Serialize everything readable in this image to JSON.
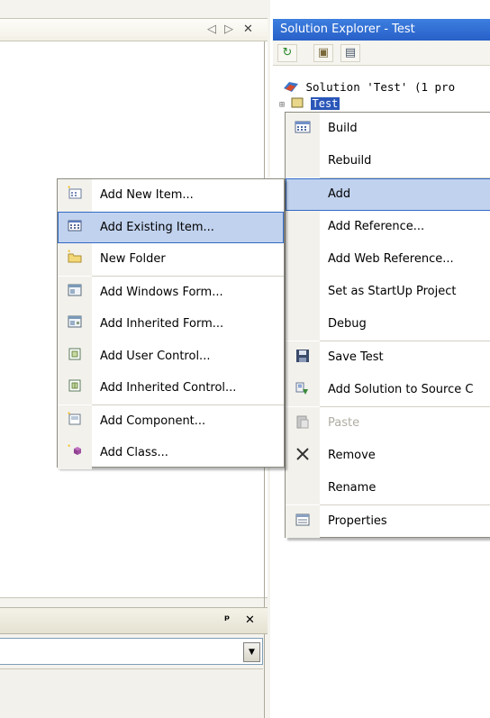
{
  "editor": {
    "nav_left": "◁",
    "nav_right": "▷",
    "close": "✕"
  },
  "bottom_window": {
    "pin": "ᵖ",
    "close": "✕",
    "combo_arrow": "▼"
  },
  "solution_explorer": {
    "title": "Solution Explorer - Test",
    "toolbar": {
      "refresh_icon": "↻",
      "show_all_icon": "▣",
      "properties_icon": "▤"
    },
    "tree": {
      "solution_label": "Solution 'Test' (1 pro",
      "project_label": "Test"
    }
  },
  "context_menu": {
    "items": [
      {
        "label": "Build",
        "icon": "build-icon"
      },
      {
        "label": "Rebuild",
        "icon": ""
      },
      {
        "label": "Add",
        "icon": ""
      },
      {
        "label": "Add Reference...",
        "icon": ""
      },
      {
        "label": "Add Web Reference...",
        "icon": ""
      },
      {
        "label": "Set as StartUp Project",
        "icon": ""
      },
      {
        "label": "Debug",
        "icon": ""
      },
      {
        "label": "Save Test",
        "icon": "save-icon"
      },
      {
        "label": "Add Solution to Source C",
        "icon": "source-control-icon"
      },
      {
        "label": "Paste",
        "icon": "paste-icon"
      },
      {
        "label": "Remove",
        "icon": "remove-icon"
      },
      {
        "label": "Rename",
        "icon": ""
      },
      {
        "label": "Properties",
        "icon": "properties-icon"
      }
    ]
  },
  "add_submenu": {
    "items": [
      {
        "label": "Add New Item...",
        "icon": "new-item-icon"
      },
      {
        "label": "Add Existing Item...",
        "icon": "existing-item-icon"
      },
      {
        "label": "New Folder",
        "icon": "new-folder-icon"
      },
      {
        "label": "Add Windows Form...",
        "icon": "windows-form-icon"
      },
      {
        "label": "Add Inherited Form...",
        "icon": "inherited-form-icon"
      },
      {
        "label": "Add User Control...",
        "icon": "user-control-icon"
      },
      {
        "label": "Add Inherited Control...",
        "icon": "inherited-control-icon"
      },
      {
        "label": "Add Component...",
        "icon": "component-icon"
      },
      {
        "label": "Add Class...",
        "icon": "class-icon"
      }
    ]
  },
  "colors": {
    "title_bar": "#2a63cc",
    "highlight": "#c1d2ee",
    "highlight_border": "#316ac5"
  }
}
